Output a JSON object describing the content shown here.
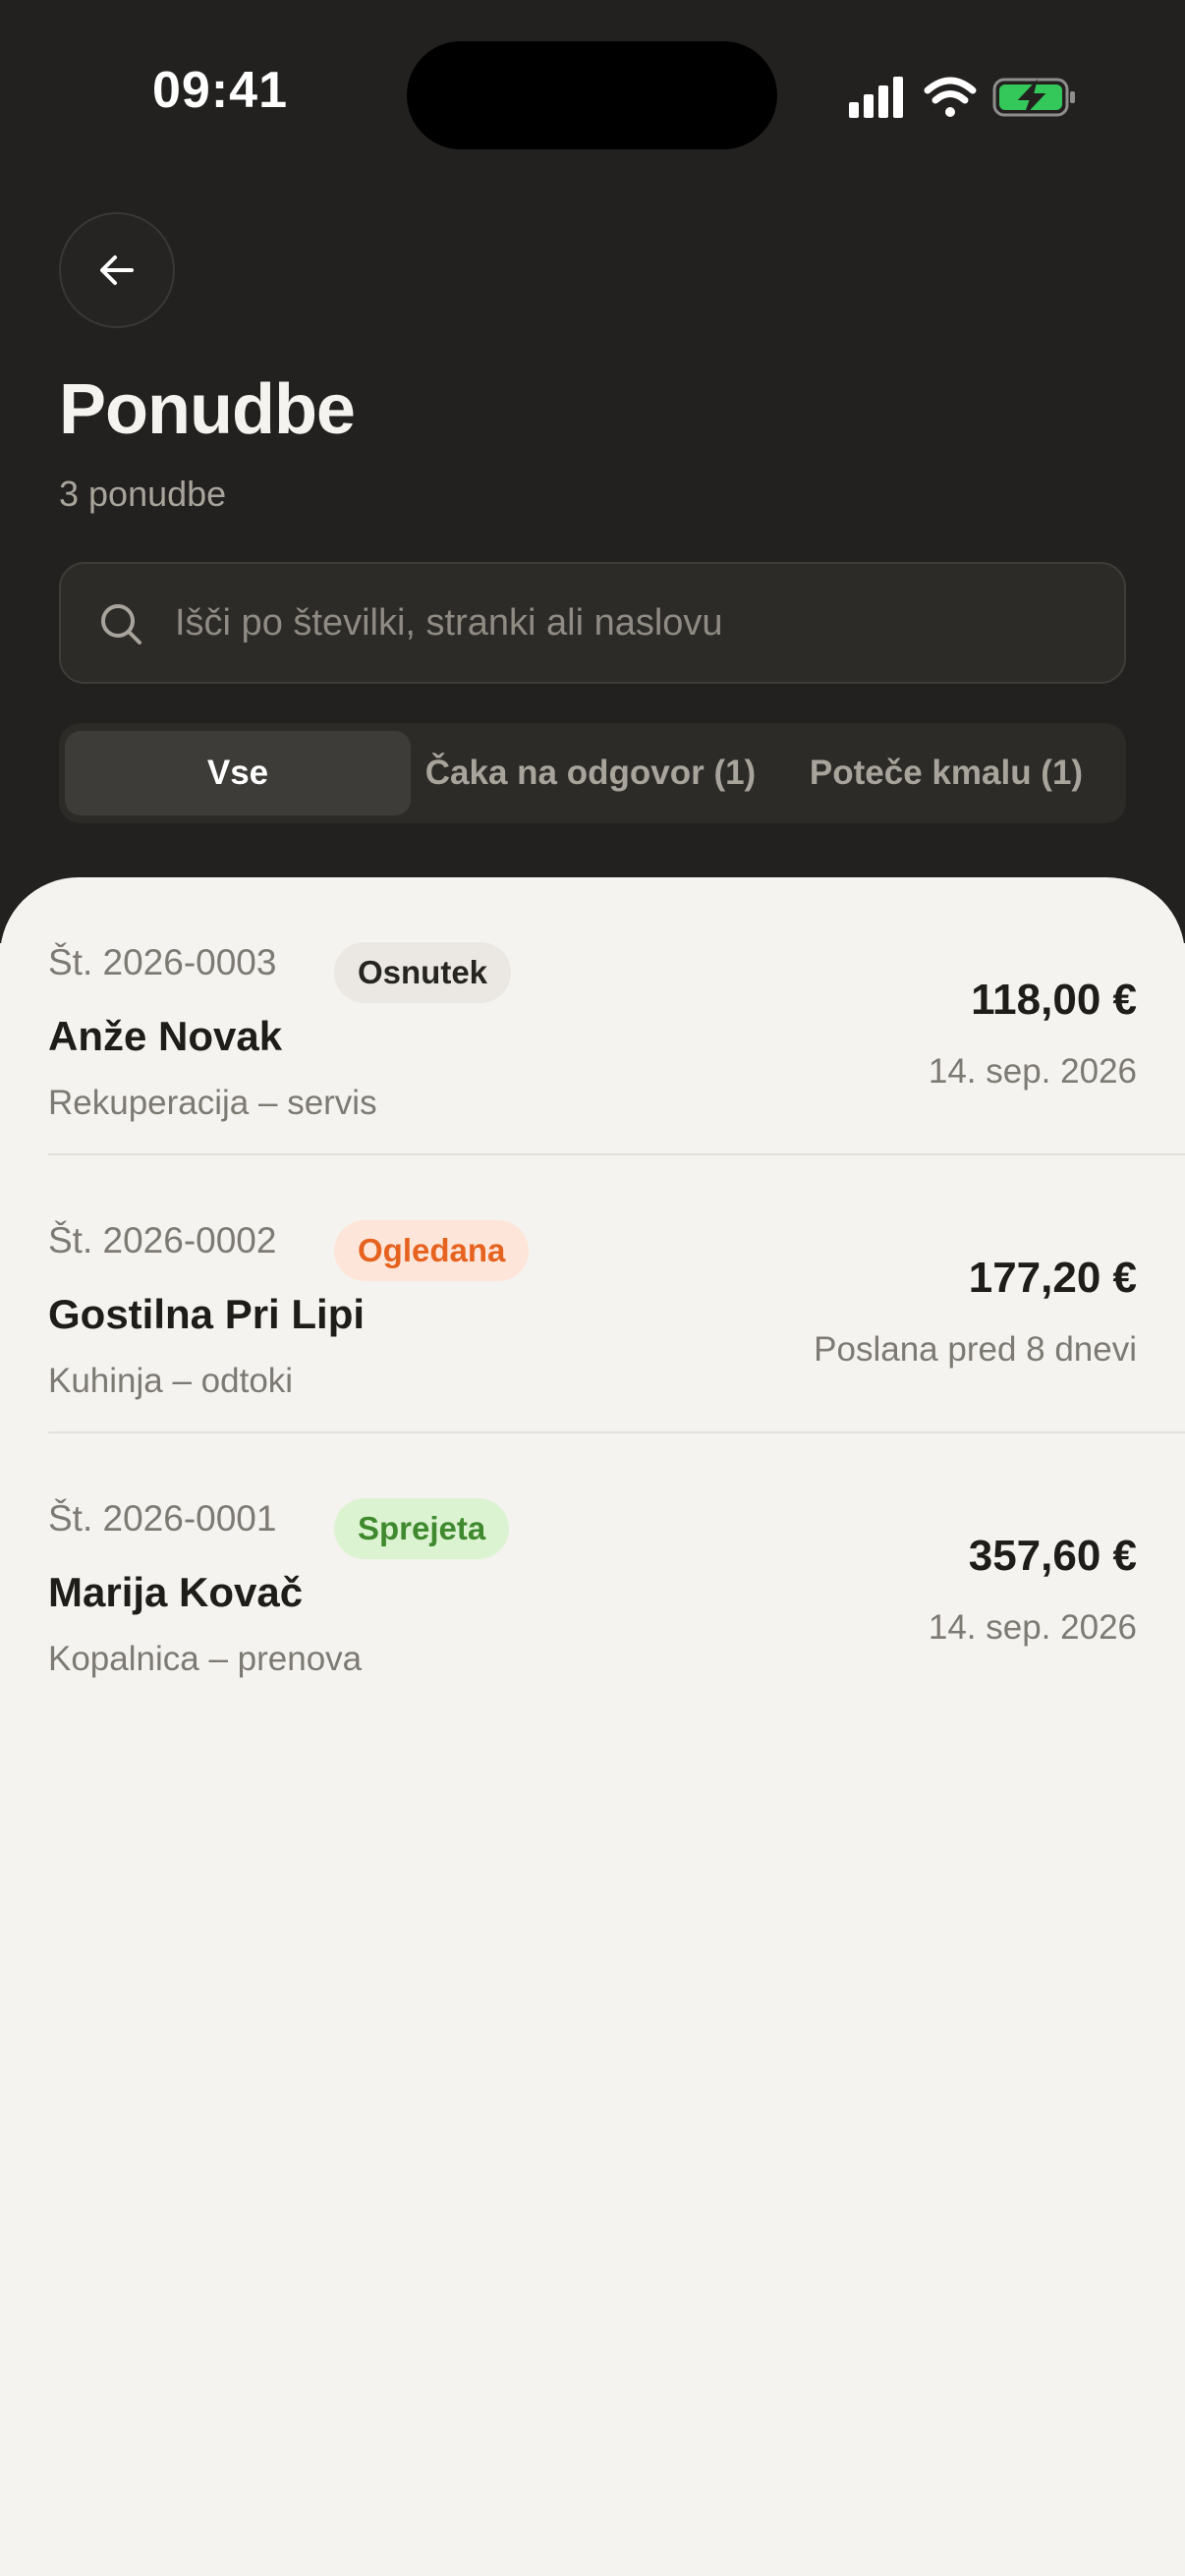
{
  "status_bar": {
    "time": "09:41"
  },
  "header": {
    "title": "Ponudbe",
    "subtitle": "3 ponudbe"
  },
  "search": {
    "placeholder": "Išči po številki, stranki ali naslovu",
    "value": ""
  },
  "filters": {
    "tabs": [
      {
        "label": "Vse",
        "active": true
      },
      {
        "label": "Čaka na odgovor (1)",
        "active": false
      },
      {
        "label": "Poteče kmalu (1)",
        "active": false
      }
    ]
  },
  "offers": [
    {
      "number": "Št. 2026-0003",
      "status": "Osnutek",
      "status_kind": "draft",
      "client": "Anže Novak",
      "job": "Rekuperacija – servis",
      "amount": "118,00 €",
      "meta": "14. sep. 2026"
    },
    {
      "number": "Št. 2026-0002",
      "status": "Ogledana",
      "status_kind": "viewed",
      "client": "Gostilna Pri Lipi",
      "job": "Kuhinja – odtoki",
      "amount": "177,20 €",
      "meta": "Poslana pred 8 dnevi"
    },
    {
      "number": "Št. 2026-0001",
      "status": "Sprejeta",
      "status_kind": "accepted",
      "client": "Marija Kovač",
      "job": "Kopalnica – prenova",
      "amount": "357,60 €",
      "meta": "14. sep. 2026"
    }
  ],
  "icons": {
    "back": "arrow-left-icon",
    "search": "search-icon",
    "signal": "cellular-signal-icon",
    "wifi": "wifi-icon",
    "battery": "battery-charging-icon"
  },
  "colors": {
    "header_background": "#22211f",
    "sheet_background": "#f5f3ef",
    "battery_green": "#34c759",
    "status_viewed": "#e6621f",
    "status_accepted": "#3f8a2e"
  }
}
